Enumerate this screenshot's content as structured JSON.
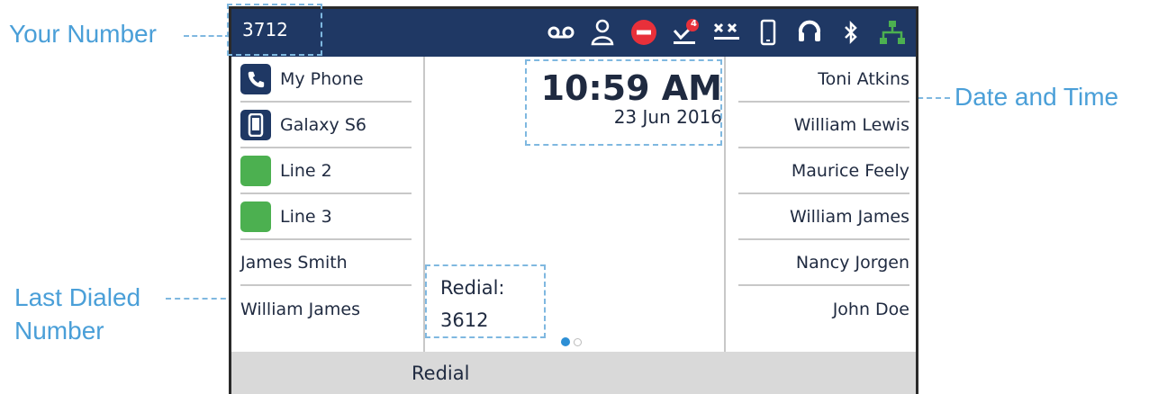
{
  "callouts": {
    "your_number": "Your Number",
    "date_and_time": "Date and Time",
    "last_dialed_line1": "Last Dialed",
    "last_dialed_line2": "Number"
  },
  "status_bar": {
    "extension": "3712",
    "icons": [
      "voicemail-icon",
      "contact-icon",
      "do-not-disturb-icon",
      "missed-calls-icon",
      "call-forward-icon",
      "mobile-icon",
      "headset-icon",
      "bluetooth-icon",
      "network-icon"
    ],
    "missed_calls_badge": "4",
    "colors": {
      "bar": "#1f3864",
      "dnd": "#e8303a",
      "badge": "#e8303a",
      "network": "#4cb050"
    }
  },
  "left_keys": [
    {
      "label": "My Phone",
      "icon": "phone-icon",
      "icon_style": "navy"
    },
    {
      "label": "Galaxy S6",
      "icon": "mobile-device-icon",
      "icon_style": "navy"
    },
    {
      "label": "Line 2",
      "icon": "line-status-icon",
      "icon_style": "green"
    },
    {
      "label": "Line 3",
      "icon": "line-status-icon",
      "icon_style": "green"
    },
    {
      "label": "James Smith"
    },
    {
      "label": "William James"
    }
  ],
  "right_keys": [
    {
      "label": "Toni Atkins"
    },
    {
      "label": "William Lewis"
    },
    {
      "label": "Maurice Feely"
    },
    {
      "label": "William James"
    },
    {
      "label": "Nancy Jorgen"
    },
    {
      "label": "John Doe"
    }
  ],
  "clock": {
    "time": "10:59 AM",
    "date": "23 Jun 2016"
  },
  "redial": {
    "label": "Redial:",
    "number": "3612"
  },
  "page_indicator": {
    "pages": 2,
    "current": 1,
    "active_color": "#2d8fd5"
  },
  "softkeys": {
    "redial": "Redial"
  }
}
